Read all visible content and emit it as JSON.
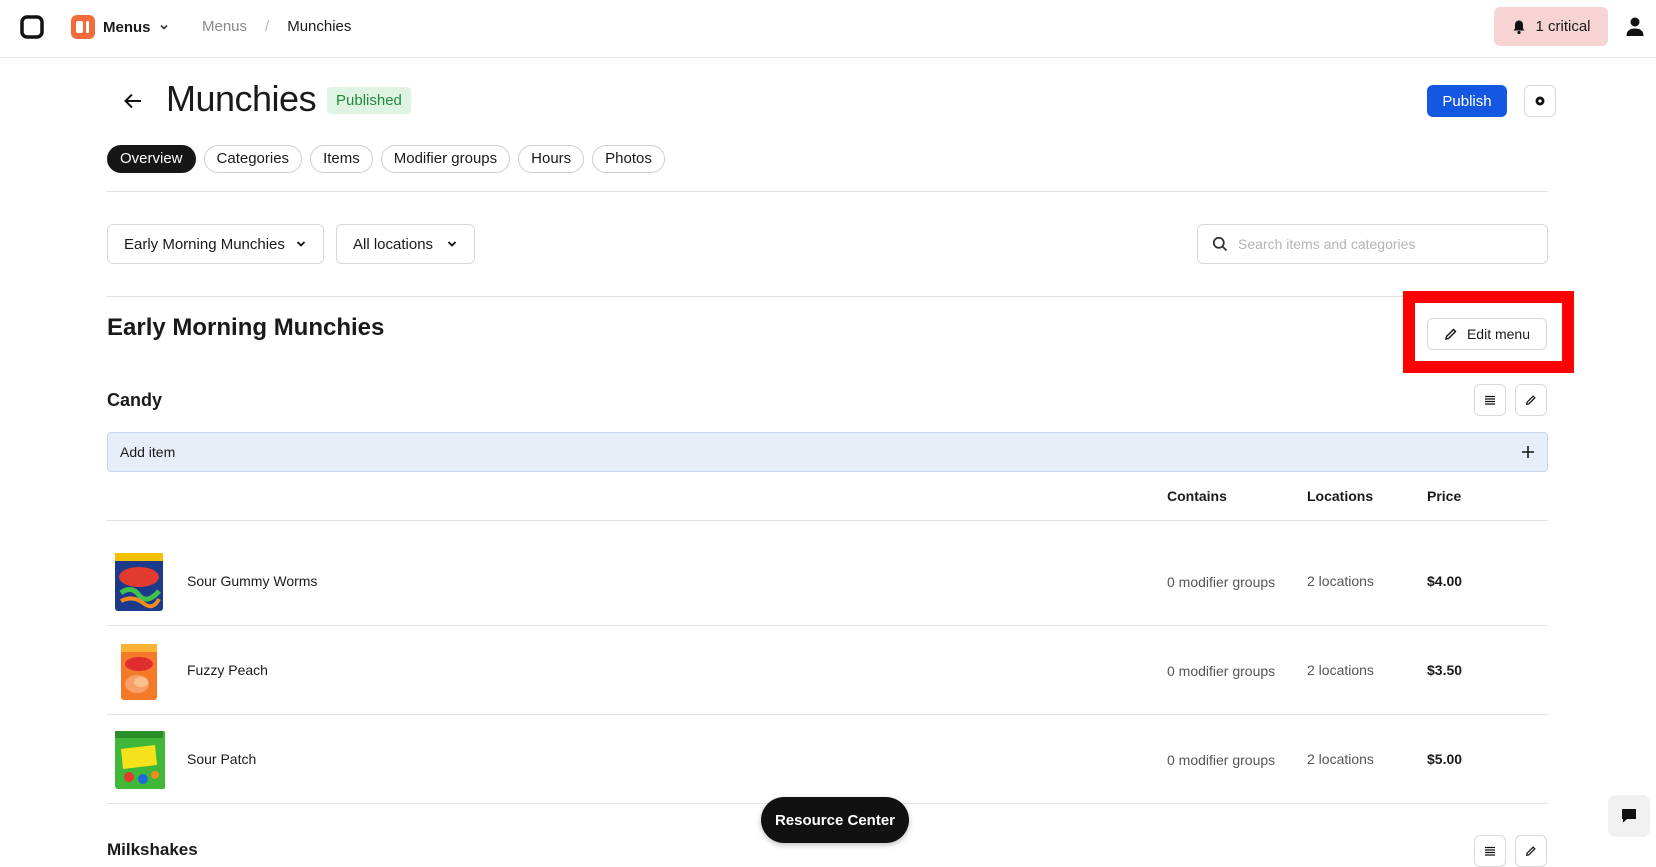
{
  "topbar": {
    "app_name": "Menus",
    "breadcrumb": {
      "parent": "Menus",
      "separator": "/",
      "current": "Munchies"
    },
    "alert_label": "1 critical"
  },
  "header": {
    "title": "Munchies",
    "status": "Published",
    "publish_label": "Publish"
  },
  "tabs": [
    {
      "label": "Overview"
    },
    {
      "label": "Categories"
    },
    {
      "label": "Items"
    },
    {
      "label": "Modifier groups"
    },
    {
      "label": "Hours"
    },
    {
      "label": "Photos"
    }
  ],
  "filters": {
    "menu_select": "Early Morning Munchies",
    "location_select": "All locations",
    "search_placeholder": "Search items and categories"
  },
  "menu_section": {
    "title": "Early Morning Munchies",
    "edit_label": "Edit menu"
  },
  "category": {
    "title": "Candy",
    "add_item_label": "Add item",
    "columns": {
      "contains": "Contains",
      "locations": "Locations",
      "price": "Price"
    },
    "items": [
      {
        "name": "Sour Gummy Worms",
        "contains": "0 modifier groups",
        "locations": "2 locations",
        "price": "$4.00"
      },
      {
        "name": "Fuzzy Peach",
        "contains": "0 modifier groups",
        "locations": "2 locations",
        "price": "$3.50"
      },
      {
        "name": "Sour Patch",
        "contains": "0 modifier groups",
        "locations": "2 locations",
        "price": "$5.00"
      }
    ]
  },
  "next_category": {
    "title": "Milkshakes"
  },
  "resource_center_label": "Resource Center",
  "colors": {
    "primary": "#1457e0",
    "alert_bg": "#f6d4d4",
    "status_bg": "#dff3e3",
    "highlight": "#ff0000"
  }
}
